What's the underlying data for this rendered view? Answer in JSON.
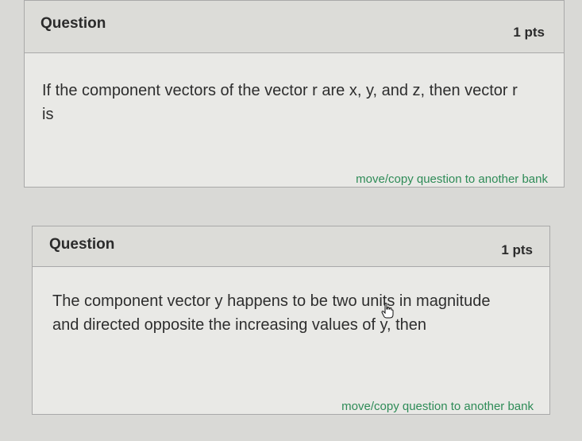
{
  "questions": [
    {
      "title": "Question",
      "points": "1 pts",
      "text": "If the component vectors of the vector r are x, y, and z, then vector r is",
      "move_link": "move/copy question to another bank"
    },
    {
      "title": "Question",
      "points": "1 pts",
      "text": "The component vector y happens to be two units in magnitude and directed opposite the increasing values of y, then",
      "move_link": "move/copy question to another bank"
    }
  ],
  "colors": {
    "link": "#2e8b57",
    "border": "#a9a9a9",
    "header_bg": "#dcdcd8",
    "body_bg": "#e9e9e6"
  },
  "icons": {
    "pointer": "arrow-cursor-icon",
    "hand": "hand-cursor-icon"
  }
}
